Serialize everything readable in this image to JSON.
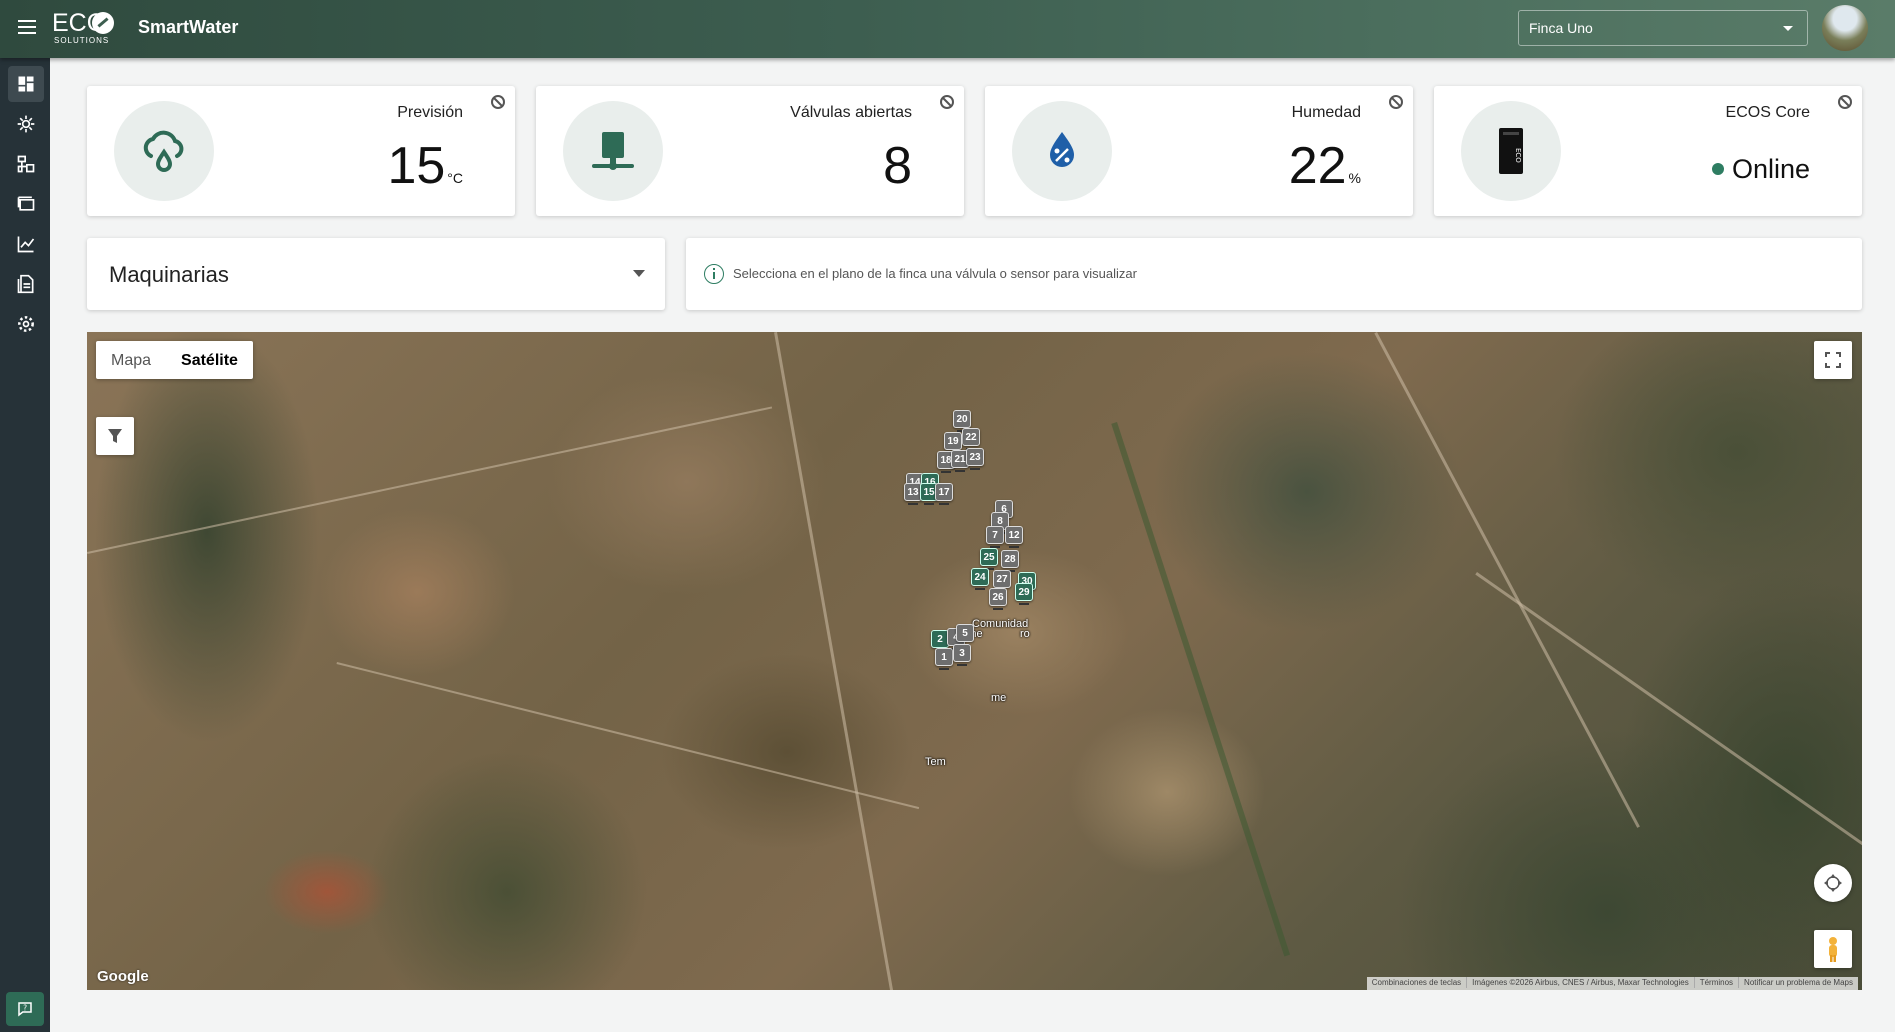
{
  "header": {
    "logo_text": "ECO",
    "logo_sub": "SOLUTIONS",
    "app_title": "SmartWater",
    "farm_selected": "Finca Uno"
  },
  "sidebar": {
    "items": [
      {
        "icon": "dashboard-icon",
        "active": true
      },
      {
        "icon": "sensors-icon",
        "active": false
      },
      {
        "icon": "schema-icon",
        "active": false
      },
      {
        "icon": "devices-icon",
        "active": false
      },
      {
        "icon": "chart-icon",
        "active": false
      },
      {
        "icon": "report-icon",
        "active": false
      },
      {
        "icon": "settings-icon",
        "active": false
      }
    ],
    "help_icon": "help-chat-icon"
  },
  "cards": {
    "forecast": {
      "title": "Previsión",
      "value": "15",
      "unit": "°C",
      "icon": "cloud-rain-icon"
    },
    "valves": {
      "title": "Válvulas abiertas",
      "value": "8",
      "icon": "valve-icon"
    },
    "humidity": {
      "title": "Humedad",
      "value": "22",
      "unit": "%",
      "icon": "water-percent-icon"
    },
    "core": {
      "title": "ECOS Core",
      "status": "Online",
      "icon": "core-device-icon"
    }
  },
  "machinery": {
    "label": "Maquinarias"
  },
  "info": {
    "text": "Selecciona en el plano de la finca una válvula o sensor para visualizar"
  },
  "map": {
    "type_options": {
      "map": "Mapa",
      "satellite": "Satélite"
    },
    "selected_type": "Satélite",
    "google": "Google",
    "attribution": {
      "shortcuts": "Combinaciones de teclas",
      "imagery": "Imágenes ©2026 Airbus, CNES / Airbus, Maxar Technologies",
      "terms": "Términos",
      "report": "Notificar un problema de Maps"
    },
    "labels": {
      "label_a": "Comunidad",
      "label_b": "Ane",
      "label_c": "ro",
      "label_d": "me",
      "label_e": "Tem"
    },
    "markers": [
      {
        "n": "20",
        "color": "gray"
      },
      {
        "n": "22",
        "color": "gray"
      },
      {
        "n": "19",
        "color": "gray"
      },
      {
        "n": "18",
        "color": "gray"
      },
      {
        "n": "21",
        "color": "gray"
      },
      {
        "n": "23",
        "color": "gray"
      },
      {
        "n": "14",
        "color": "gray"
      },
      {
        "n": "16",
        "color": "green"
      },
      {
        "n": "13",
        "color": "gray"
      },
      {
        "n": "15",
        "color": "green"
      },
      {
        "n": "17",
        "color": "gray"
      },
      {
        "n": "6",
        "color": "gray"
      },
      {
        "n": "8",
        "color": "gray"
      },
      {
        "n": "7",
        "color": "gray"
      },
      {
        "n": "12",
        "color": "gray"
      },
      {
        "n": "25",
        "color": "green"
      },
      {
        "n": "28",
        "color": "gray"
      },
      {
        "n": "24",
        "color": "green"
      },
      {
        "n": "27",
        "color": "gray"
      },
      {
        "n": "30",
        "color": "green"
      },
      {
        "n": "29",
        "color": "green"
      },
      {
        "n": "26",
        "color": "gray"
      },
      {
        "n": "2",
        "color": "green"
      },
      {
        "n": "4",
        "color": "gray"
      },
      {
        "n": "5",
        "color": "gray"
      },
      {
        "n": "1",
        "color": "gray"
      },
      {
        "n": "3",
        "color": "gray"
      }
    ]
  },
  "colors": {
    "accent": "#2e6b56",
    "sidebar": "#263238",
    "online": "#2e7d62"
  }
}
